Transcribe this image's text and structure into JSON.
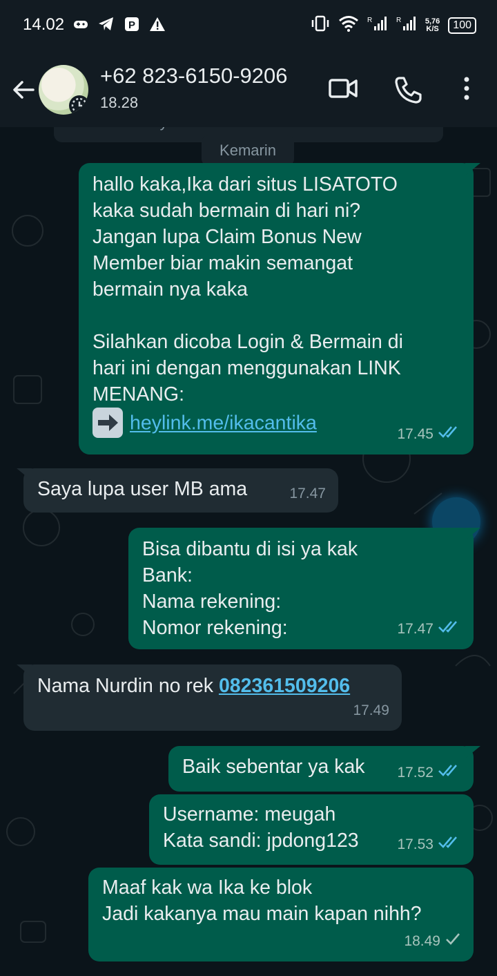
{
  "status_bar": {
    "time": "14.02",
    "net_speed_value": "5,76",
    "net_speed_unit": "K/S",
    "battery": "100",
    "left_icons": [
      "game-controller-icon",
      "telegram-icon",
      "parking-app-icon",
      "warning-icon"
    ],
    "right_icons": [
      "vibrate-icon",
      "wifi-icon",
      "signal-r-icon",
      "signal-r2-icon"
    ]
  },
  "header": {
    "contact": "+62 823-6150-9206",
    "status": "18.28"
  },
  "chat": {
    "partial_text": "menyetel timer sendiri Anda sendiri",
    "date_chip": "Kemarin",
    "messages": [
      {
        "id": "m1",
        "direction": "out",
        "lines": [
          "hallo kaka,Ika dari situs LISATOTO",
          "kaka sudah bermain di hari ni?",
          "Jangan lupa Claim Bonus New",
          "Member biar makin semangat",
          "bermain nya kaka",
          "",
          "Silahkan dicoba Login & Bermain di",
          "hari ini dengan menggunakan LINK",
          "MENANG:"
        ],
        "link": "heylink.me/ikacantika",
        "time": "17.45",
        "ticks": "double-blue"
      },
      {
        "id": "m2",
        "direction": "in",
        "text": "Saya lupa user MB ama",
        "time": "17.47"
      },
      {
        "id": "m3",
        "direction": "out",
        "lines": [
          "Bisa dibantu di isi ya kak",
          "Bank:",
          "Nama rekening:",
          "Nomor rekening:"
        ],
        "time": "17.47",
        "ticks": "double-blue"
      },
      {
        "id": "m4",
        "direction": "in",
        "text": "Nama Nurdin no rek ",
        "phone_link": "082361509206",
        "time": "17.49"
      },
      {
        "id": "m5",
        "direction": "out",
        "text": "Baik sebentar ya kak",
        "time": "17.52",
        "ticks": "double-blue"
      },
      {
        "id": "m6",
        "direction": "out",
        "lines": [
          "Username: meugah",
          "Kata sandi: jpdong123"
        ],
        "time": "17.53",
        "ticks": "double-blue"
      },
      {
        "id": "m7",
        "direction": "out",
        "lines": [
          "Maaf kak wa Ika ke blok",
          "Jadi kakanya mau main kapan nihh?"
        ],
        "time": "18.49",
        "ticks": "single-gray"
      }
    ]
  },
  "colors": {
    "background": "#0b141a",
    "header": "#121b22",
    "outgoing_bubble": "#005c4b",
    "incoming_bubble": "#202c33",
    "read_tick": "#53bdeb",
    "link": "#53bdeb"
  }
}
